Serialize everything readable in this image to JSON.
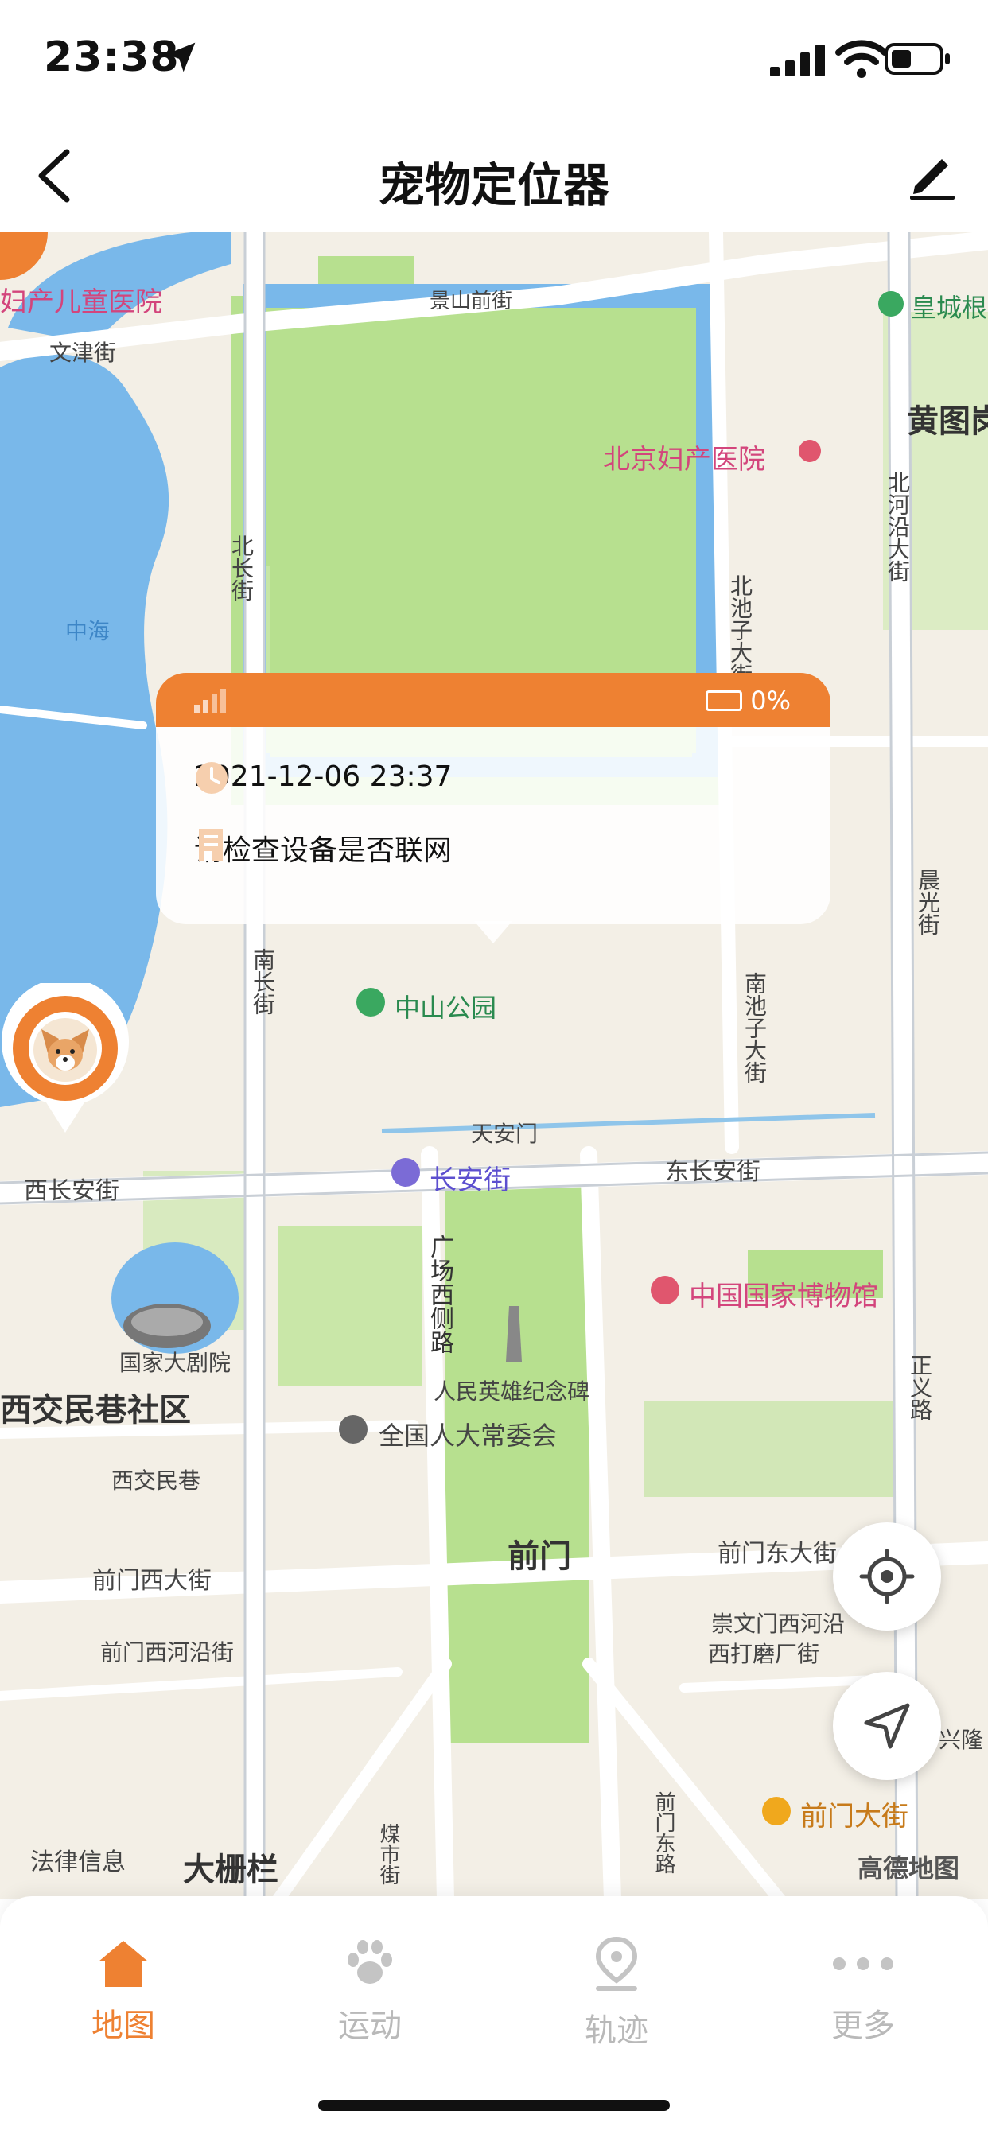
{
  "status_bar": {
    "time": "23:38"
  },
  "navbar": {
    "title": "宠物定位器"
  },
  "map_labels": {
    "hospital_partial": "妇产儿童医院",
    "wenjin": "文津街",
    "jingshan": "景山前街",
    "huangcheng": "皇城根",
    "huangtugang": "黄图岗",
    "fuchan": "北京妇产医院",
    "beichang": "北长街",
    "zhonghai": "中海",
    "beichizi": "北池子大街",
    "beiheyan": "北河沿大街",
    "nanchang": "南长街",
    "zhongshan": "中山公园",
    "nanchizi": "南池子大街",
    "chenguang": "晨光街",
    "tiananmen": "天安门",
    "xichangan": "西长安街",
    "changanjie": "长安街",
    "dongchangan": "东长安街",
    "guangchangxi": "广场西侧路",
    "museum": "中国国家博物馆",
    "theatre": "国家大剧院",
    "monument": "人民英雄纪念碑",
    "xijiaominxiang_comm": "西交民巷社区",
    "npc": "全国人大常委会",
    "zhengyi": "正义路",
    "xijiaominxiang": "西交民巷",
    "qianmen": "前门",
    "qianmenxi": "前门西大街",
    "qianmendong": "前门东大街",
    "chongwenmen": "崇文门西河沿",
    "xidamochang": "西打磨厂街",
    "qianmenxiheyan": "前门西河沿街",
    "qianmendonglu": "前门东路",
    "qianmendajie": "前门大街",
    "meishi": "煤市街",
    "falv": "法律信息",
    "dashilan": "大栅栏",
    "xinglong": "兴隆"
  },
  "popup": {
    "battery": "0%",
    "timestamp": "2021-12-06 23:37",
    "message": "请检查设备是否联网"
  },
  "map_attribution": "高德地图",
  "tabs": [
    {
      "label": "地图",
      "icon": "home-icon",
      "active": true
    },
    {
      "label": "运动",
      "icon": "paw-icon",
      "active": false
    },
    {
      "label": "轨迹",
      "icon": "track-icon",
      "active": false
    },
    {
      "label": "更多",
      "icon": "more-icon",
      "active": false
    }
  ],
  "colors": {
    "accent": "#ee8132",
    "water": "#79b8ea",
    "park": "#b7e08f"
  }
}
